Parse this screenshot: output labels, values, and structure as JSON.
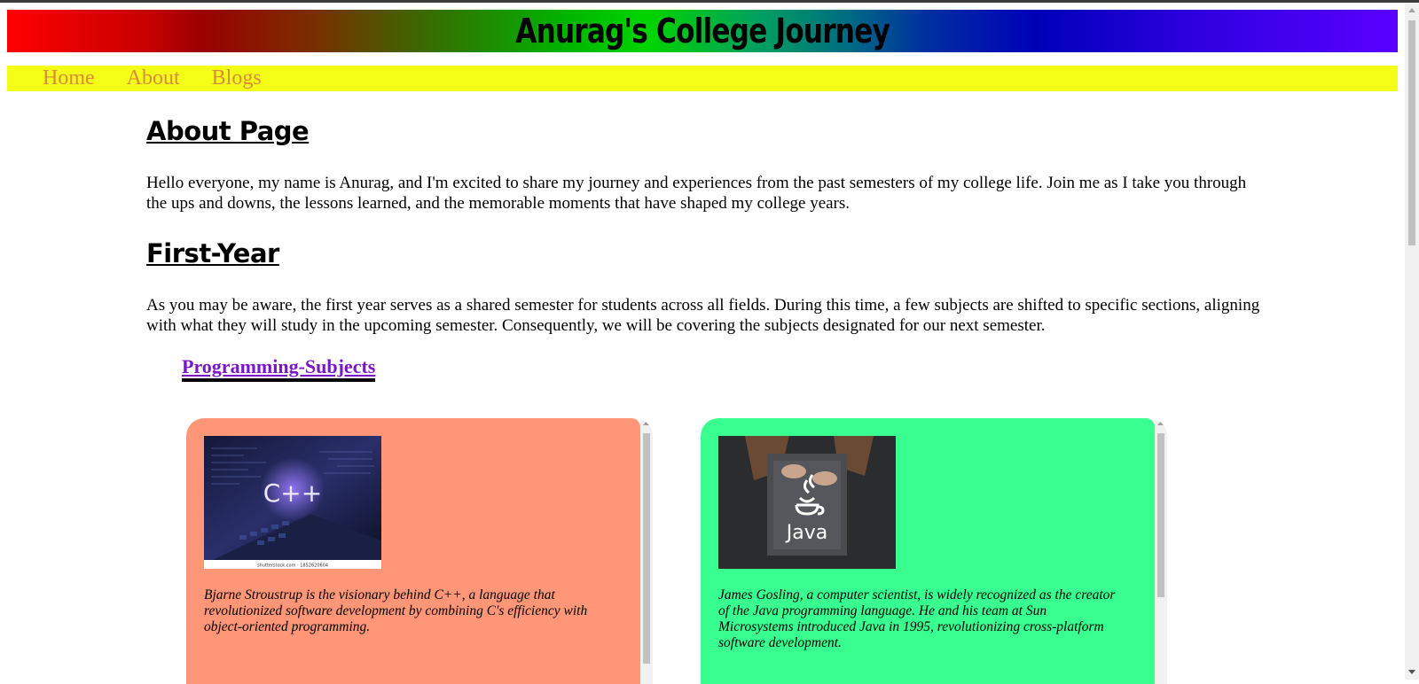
{
  "site": {
    "title": "Anurag's College Journey"
  },
  "nav": {
    "items": [
      "Home",
      "About",
      "Blogs"
    ]
  },
  "about": {
    "heading": "About Page",
    "text": "Hello everyone, my name is Anurag, and I'm excited to share my journey and experiences from the past semesters of my college life. Join me as I take you through the ups and downs, the lessons learned, and the memorable moments that have shaped my college years."
  },
  "first_year": {
    "heading": "First-Year",
    "text": "As you may be aware, the first year serves as a shared semester for students across all fields. During this time, a few subjects are shifted to specific sections, aligning with what they will study in the upcoming semester. Consequently, we will be covering the subjects designated for our next semester."
  },
  "programming": {
    "heading": "Programming-Subjects",
    "cards": [
      {
        "image_label": "C++",
        "image_caption": "shutterstock.com · 1852620604",
        "text": "Bjarne Stroustrup is the visionary behind C++, a language that revolutionized software development by combining C's efficiency with object-oriented programming.",
        "color": "#ff9677"
      },
      {
        "image_label": "Java",
        "text": "James Gosling, a computer scientist, is widely recognized as the creator of the Java programming language. He and his team at Sun Microsystems introduced Java in 1995, revolutionizing cross-platform software development.",
        "color": "#38ff8f"
      }
    ]
  }
}
